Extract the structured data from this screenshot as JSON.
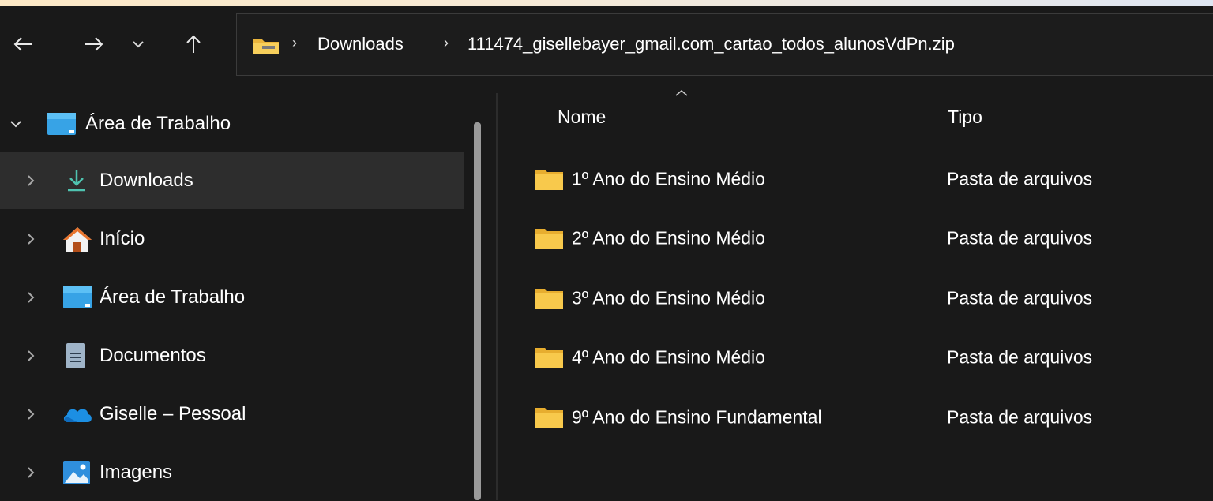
{
  "window": {
    "accent": "#4fc3b0",
    "background": "#191919"
  },
  "navigation": {
    "back_icon": "arrow-left-icon",
    "forward_icon": "arrow-right-icon",
    "recent_icon": "chevron-down-icon",
    "up_icon": "arrow-up-icon"
  },
  "address": {
    "icon": "folder-icon",
    "crumbs": [
      "Downloads",
      "111474_gisellebayer_gmail.com_cartao_todos_alunosVdPn.zip"
    ]
  },
  "sidebar": {
    "items": [
      {
        "label": "Área de Trabalho",
        "icon": "desktop-icon",
        "expanded": true
      },
      {
        "label": "Downloads",
        "icon": "download-icon",
        "selected": true
      },
      {
        "label": "Início",
        "icon": "home-icon"
      },
      {
        "label": "Área de Trabalho",
        "icon": "desktop-icon"
      },
      {
        "label": "Documentos",
        "icon": "document-icon"
      },
      {
        "label": "Giselle – Pessoal",
        "icon": "onedrive-cloud-icon"
      },
      {
        "label": "Imagens",
        "icon": "pictures-icon"
      }
    ]
  },
  "file_list": {
    "columns": {
      "name": "Nome",
      "type": "Tipo"
    },
    "rows": [
      {
        "name": "1º Ano do Ensino Médio",
        "type": "Pasta de arquivos"
      },
      {
        "name": "2º Ano do Ensino Médio",
        "type": "Pasta de arquivos"
      },
      {
        "name": "3º Ano do Ensino Médio",
        "type": "Pasta de arquivos"
      },
      {
        "name": "4º Ano do Ensino Médio",
        "type": "Pasta de arquivos"
      },
      {
        "name": "9º Ano do Ensino Fundamental",
        "type": "Pasta de arquivos"
      }
    ]
  }
}
